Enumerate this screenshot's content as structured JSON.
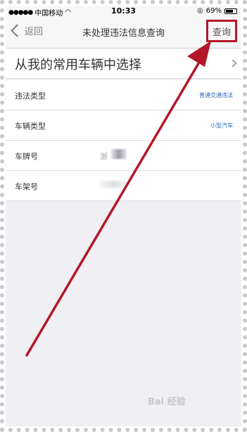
{
  "status_bar": {
    "carrier": "中国移动",
    "time": "10:33",
    "battery": "69%",
    "battery_level": 0.69
  },
  "nav": {
    "back_label": "返回",
    "title": "未处理违法信息查询",
    "query_label": "查询"
  },
  "select_vehicle_label": "从我的常用车辆中选择",
  "form_rows": [
    {
      "label": "违法类型",
      "value": "普通交通违法"
    },
    {
      "label": "车辆类型",
      "value": "小型汽车"
    },
    {
      "label": "车牌号",
      "value": "浙"
    },
    {
      "label": "车架号",
      "value": ""
    }
  ],
  "watermark": "Bai 经验",
  "colors": {
    "highlight": "#b3172a",
    "link": "#2a66b8",
    "background": "#efeff4"
  }
}
